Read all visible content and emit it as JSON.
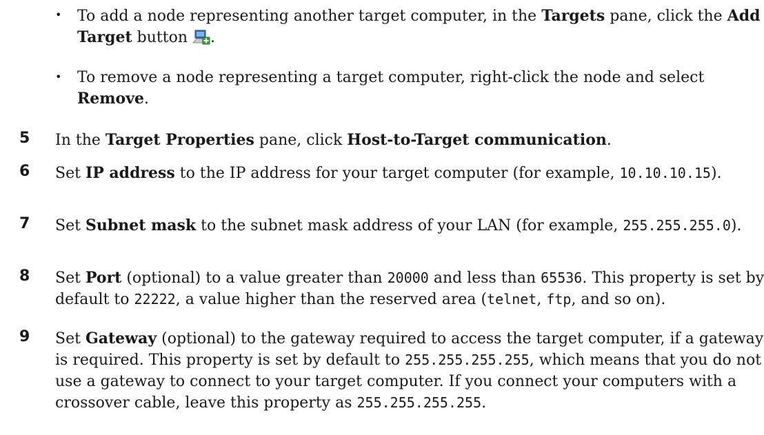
{
  "bullets": [
    {
      "t1": "To add a node representing another target computer, in the ",
      "b1": "Targets",
      "t2": " pane, click the ",
      "b2": "Add Target",
      "t3": " button ",
      "t4": "."
    },
    {
      "t1": "To remove a node representing a target computer, right-click the node and select ",
      "b1": "Remove",
      "t2": "."
    }
  ],
  "steps": [
    {
      "num": "5",
      "t1": "In the ",
      "b1": "Target Properties",
      "t2": " pane, click ",
      "b2": "Host-to-Target communication",
      "t3": "."
    },
    {
      "num": "6",
      "t1": "Set ",
      "b1": "IP address",
      "t2": " to the IP address for your target computer (for example, ",
      "c1": "10.10.10.15",
      "t3": ")."
    },
    {
      "num": "7",
      "t1": "Set ",
      "b1": "Subnet mask",
      "t2": " to the subnet mask address of your LAN (for example, ",
      "c1": "255.255.255.0",
      "t3": ")."
    },
    {
      "num": "8",
      "t1": "Set ",
      "b1": "Port",
      "t2": " (optional) to a value greater than ",
      "c1": "20000",
      "t3": " and less than ",
      "c2": "65536",
      "t4": ". This property is set by default to ",
      "c3": "22222",
      "t5": ", a value higher than the reserved area (",
      "c4": "telnet",
      "t6": ", ",
      "c5": "ftp",
      "t7": ", and so on)."
    },
    {
      "num": "9",
      "t1": "Set ",
      "b1": "Gateway",
      "t2": " (optional) to the gateway required to access the target computer, if a gateway is required. This property is set by default to ",
      "c1": "255.255.255.255",
      "t3": ", which means that you do not use a gateway to connect to your target computer. If you connect your computers with a crossover cable, leave this property as ",
      "c2": "255.255.255.255",
      "t4": "."
    }
  ],
  "icons": {
    "add_target": "add-target-icon"
  }
}
